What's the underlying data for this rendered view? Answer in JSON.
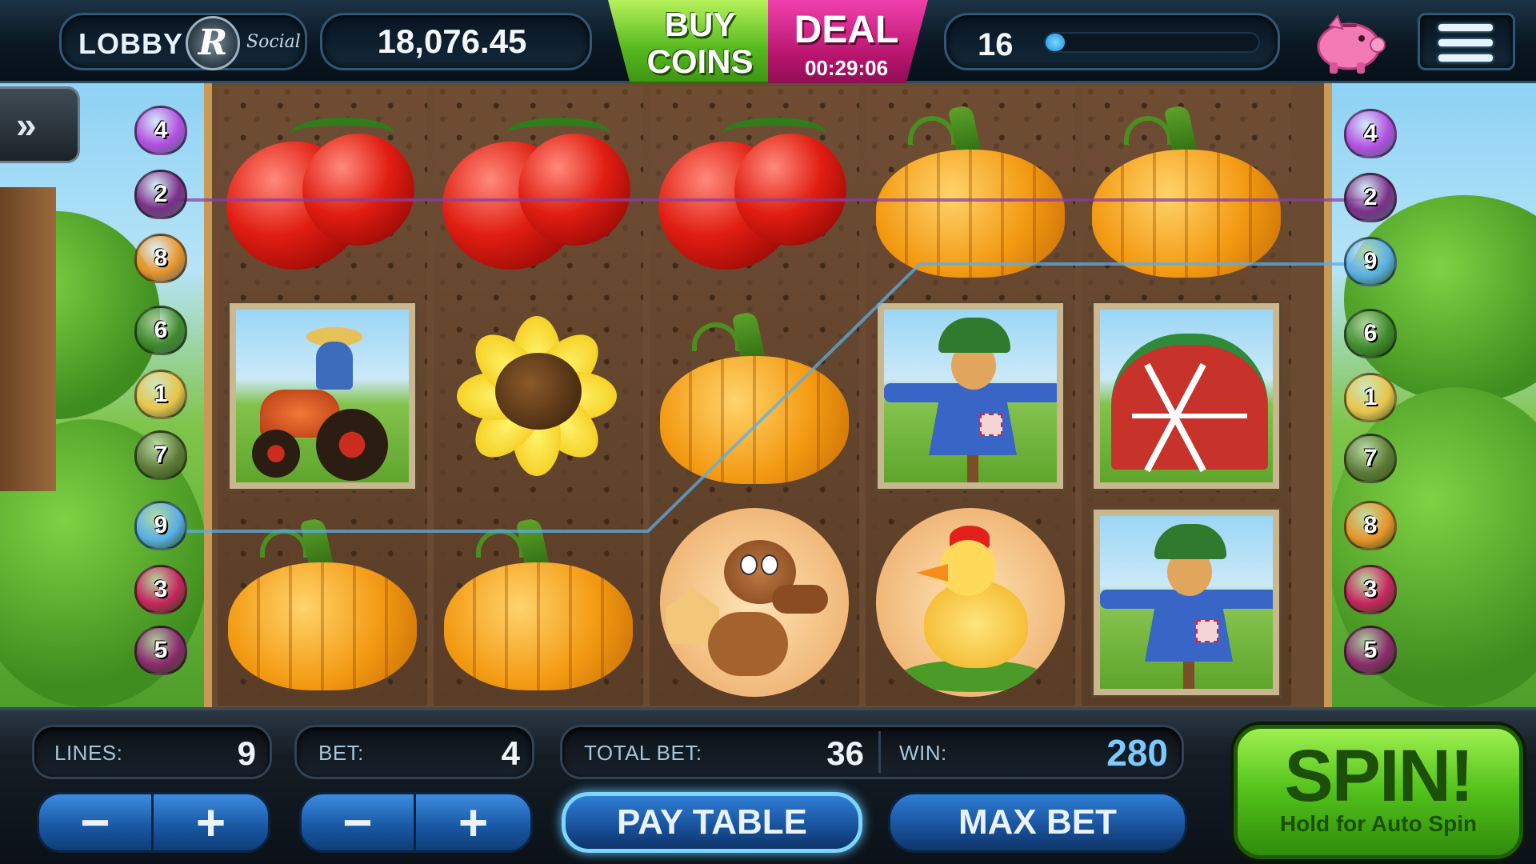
{
  "header": {
    "lobby_label": "LOBBY",
    "logo_letter": "R",
    "logo_text": "Social",
    "balance": "18,076.45",
    "buy_coins_line1": "BUY",
    "buy_coins_line2": "COINS",
    "deal_label": "DEAL",
    "deal_timer": "00:29:06",
    "level": "16",
    "xp_progress_fraction": 0.03,
    "piggy_icon": "piggy-bank-icon",
    "menu_icon": "hamburger-menu-icon"
  },
  "side_tab": {
    "label": "»",
    "icon": "double-chevron-right-icon"
  },
  "reels": [
    [
      "tomato",
      "tractor",
      "pumpkin"
    ],
    [
      "tomato",
      "sunflower",
      "pumpkin"
    ],
    [
      "tomato",
      "pumpkin",
      "dog"
    ],
    [
      "pumpkin",
      "scarecrow",
      "chicken"
    ],
    [
      "pumpkin",
      "barn",
      "scarecrow"
    ]
  ],
  "paylines_left": [
    "4",
    "2",
    "8",
    "6",
    "1",
    "7",
    "9",
    "3",
    "5"
  ],
  "paylines_right": [
    "4",
    "2",
    "9",
    "6",
    "1",
    "7",
    "8",
    "3",
    "5"
  ],
  "payline_colors": {
    "1": "#e9c34a",
    "2": "#7a2f86",
    "3": "#c7245e",
    "4": "#b34fe0",
    "5": "#8b2a6e",
    "6": "#3f8a2c",
    "7": "#5f7a3a",
    "8": "#e8932a",
    "9": "#5aaee6"
  },
  "footer": {
    "lines_label": "LINES:",
    "lines_value": "9",
    "bet_label": "BET:",
    "bet_value": "4",
    "total_bet_label": "TOTAL BET:",
    "total_bet_value": "36",
    "win_label": "WIN:",
    "win_value": "280",
    "minus": "−",
    "plus": "+",
    "pay_table_label": "PAY TABLE",
    "max_bet_label": "MAX BET",
    "spin_label": "SPIN!",
    "spin_sub": "Hold for Auto Spin"
  }
}
